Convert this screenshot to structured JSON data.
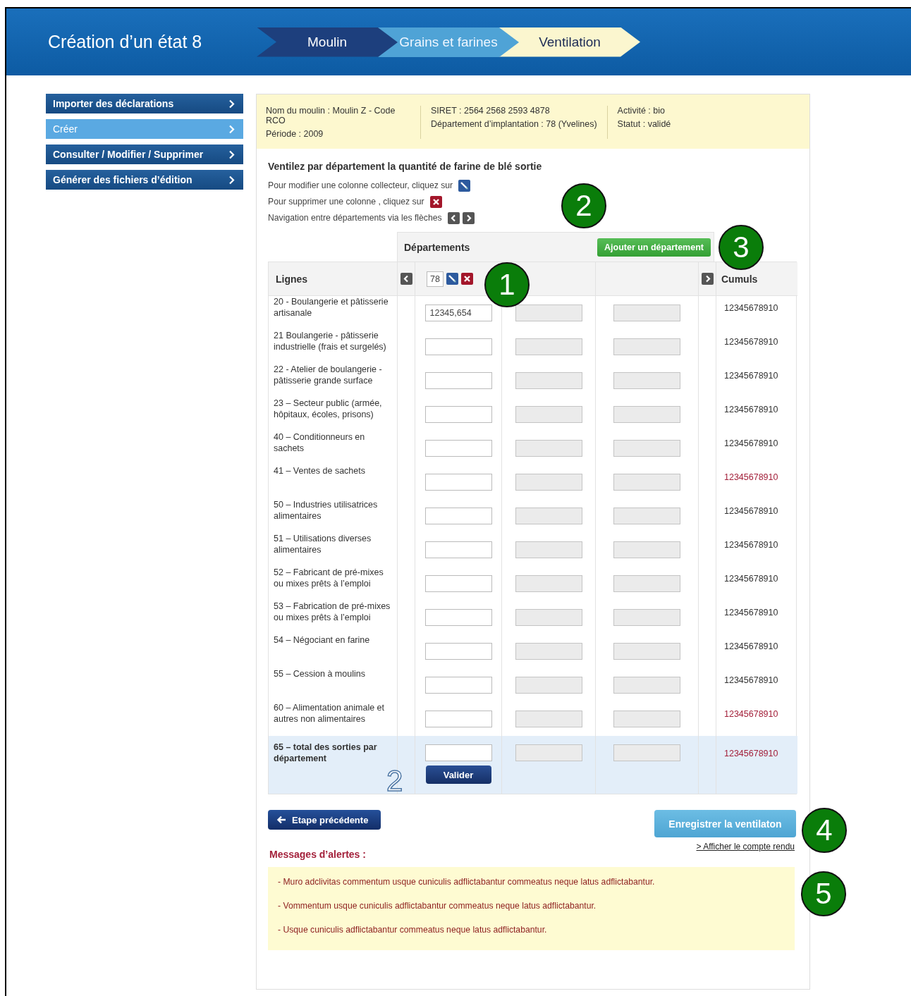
{
  "header": {
    "title": "Création d’un état 8",
    "steps": [
      {
        "label": "Moulin",
        "color": "#1d3f7d",
        "selected": false
      },
      {
        "label": "Grains et farines",
        "color": "#4fa3d6",
        "selected": false
      },
      {
        "label": "Ventilation",
        "color": "#fbf6cf",
        "selected": true
      }
    ]
  },
  "sidebar": {
    "items": [
      {
        "label": "Importer des déclarations",
        "selected": false
      },
      {
        "label": "Créer",
        "selected": true
      },
      {
        "label": "Consulter / Modifier / Supprimer",
        "selected": false
      },
      {
        "label": "Générer des fichiers d’édition",
        "selected": false
      }
    ]
  },
  "info": {
    "columns": [
      [
        "Nom du moulin : Moulin Z - Code RCO",
        "Période : 2009"
      ],
      [
        "SIRET : 2564 2568 2593 4878",
        "Département d’implantation : 78 (Yvelines)"
      ],
      [
        "Activité : bio",
        "Statut : validé"
      ]
    ]
  },
  "instructions": {
    "heading": "Ventilez par département  la quantité de farine de blé sortie",
    "lines": [
      {
        "text": "Pour  modifier une colonne collecteur, cliquez sur",
        "kind": "edit"
      },
      {
        "text": "Pour supprimer une colonne , cliquez sur",
        "kind": "delete"
      },
      {
        "text": "Navigation entre départements via les flèches",
        "kind": "arrows"
      }
    ]
  },
  "table": {
    "group_heading": "Départements",
    "add_button": "Ajouter un département",
    "lines_heading": "Lignes",
    "cumuls_heading": "Cumuls",
    "departments": [
      {
        "code": "78",
        "active": true
      },
      {
        "active": false
      },
      {
        "active": false
      }
    ],
    "rows": [
      {
        "label": "20 - Boulangerie et pâtisserie artisanale",
        "value": "12345,654",
        "cumul": "12345678910",
        "alert": false
      },
      {
        "label": "21 Boulangerie - pâtisserie industrielle (frais et surgelés)",
        "cumul": "12345678910",
        "alert": false
      },
      {
        "label": "22 - Atelier de boulangerie  - pâtisserie grande surface",
        "cumul": "12345678910",
        "alert": false
      },
      {
        "label": "23 – Secteur public (armée, hôpitaux, écoles, prisons)",
        "cumul": "12345678910",
        "alert": false
      },
      {
        "label": "40 – Conditionneurs en sachets",
        "cumul": "12345678910",
        "alert": false
      },
      {
        "label": "41 – Ventes de sachets",
        "cumul": "12345678910",
        "alert": true
      },
      {
        "label": "50 – Industries utilisatrices alimentaires",
        "cumul": "12345678910",
        "alert": false
      },
      {
        "label": "51 – Utilisations diverses alimentaires",
        "cumul": "12345678910",
        "alert": false
      },
      {
        "label": "52 – Fabricant de pré-mixes ou mixes prêts à l’emploi",
        "cumul": "12345678910",
        "alert": false
      },
      {
        "label": "53 – Fabrication de pré-mixes ou mixes prêts à l’emploi",
        "cumul": "12345678910",
        "alert": false
      },
      {
        "label": "54 – Négociant en farine",
        "cumul": "12345678910",
        "alert": false
      },
      {
        "label": "55 – Cession à moulins",
        "cumul": "12345678910",
        "alert": false
      },
      {
        "label": "60 – Alimentation animale et autres non alimentaires",
        "cumul": "12345678910",
        "alert": true
      }
    ],
    "total": {
      "label": "65 – total des sorties par département",
      "button": "Valider",
      "cumul": "12345678910",
      "alert": true,
      "mark": "2"
    }
  },
  "actions": {
    "back": "Etape précédente",
    "save": "Enregistrer la ventilaton",
    "report": "> Afficher le compte rendu"
  },
  "alerts": {
    "title": "Messages d’alertes :",
    "messages": [
      "- Muro adclivitas commentum usque cuniculis adflictabantur commeatus neque latus adflictabantur.",
      "- Vommentum usque cuniculis adflictabantur commeatus neque latus adflictabantur.",
      "- Usque cuniculis adflictabantur commeatus neque latus adflictabantur."
    ]
  },
  "callouts": [
    "1",
    "2",
    "3",
    "4",
    "5"
  ]
}
